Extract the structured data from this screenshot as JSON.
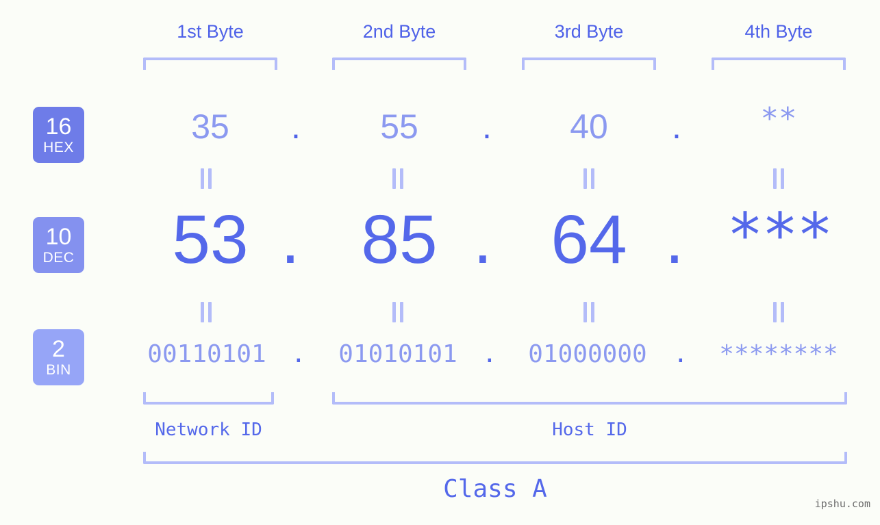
{
  "page": {
    "background_color": "#fbfdf8",
    "accent_color": "#5468ea",
    "light_accent_color": "#b3bcf9",
    "watermark": "ipshu.com"
  },
  "byte_headers": [
    {
      "label": "1st Byte"
    },
    {
      "label": "2nd Byte"
    },
    {
      "label": "3rd Byte"
    },
    {
      "label": "4th Byte"
    }
  ],
  "radix_rows": [
    {
      "badge_number": "16",
      "badge_name": "HEX",
      "badge_color": "#6e7ce8",
      "values": [
        "35",
        "55",
        "40",
        "**"
      ],
      "separator": "."
    },
    {
      "badge_number": "10",
      "badge_name": "DEC",
      "badge_color": "#8491ef",
      "values": [
        "53",
        "85",
        "64",
        "***"
      ],
      "separator": "."
    },
    {
      "badge_number": "2",
      "badge_name": "BIN",
      "badge_color": "#96a5f7",
      "values": [
        "00110101",
        "01010101",
        "01000000",
        "********"
      ],
      "separator": "."
    }
  ],
  "equals_symbol": "||",
  "footer": {
    "network_id": "Network ID",
    "host_id": "Host ID",
    "class_label": "Class A"
  }
}
